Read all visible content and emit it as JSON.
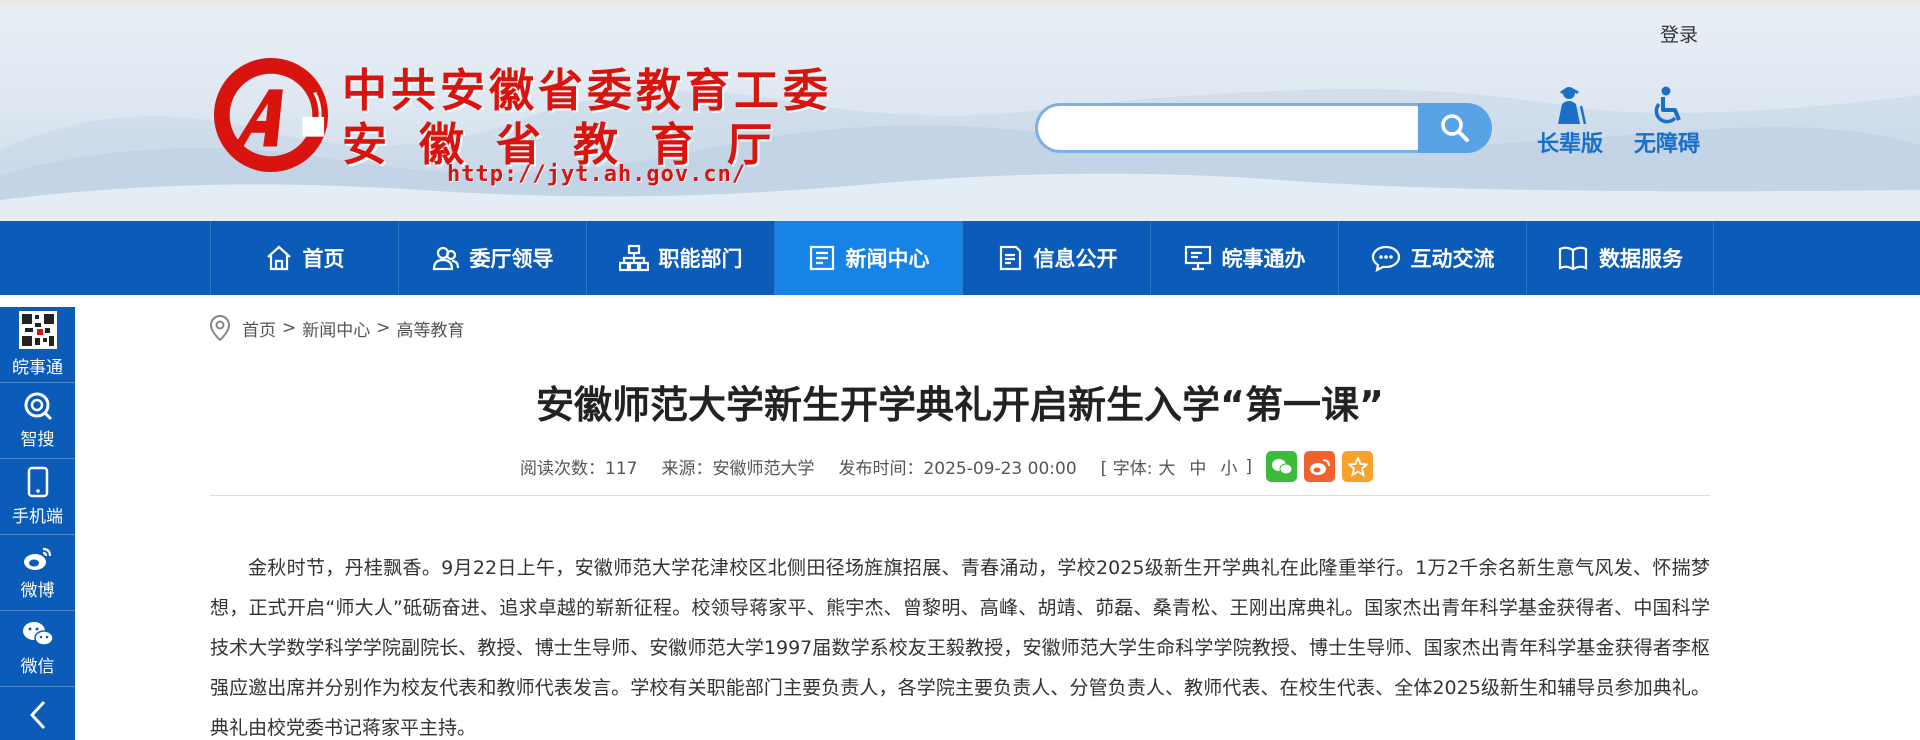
{
  "header": {
    "login": "登录",
    "logo_line1": "中共安徽省委教育工委",
    "logo_line2": "安徽省教育厅",
    "logo_url": "http://jyt.ah.gov.cn/",
    "search": {
      "placeholder": "",
      "value": ""
    },
    "links": [
      {
        "label": "长辈版",
        "icon": "elder-icon"
      },
      {
        "label": "无障碍",
        "icon": "wheelchair-icon"
      }
    ]
  },
  "nav": {
    "items": [
      {
        "label": "首页",
        "icon": "home-icon"
      },
      {
        "label": "委厅领导",
        "icon": "people-icon"
      },
      {
        "label": "职能部门",
        "icon": "org-chart-icon"
      },
      {
        "label": "新闻中心",
        "icon": "news-icon",
        "active": true
      },
      {
        "label": "信息公开",
        "icon": "document-icon"
      },
      {
        "label": "皖事通办",
        "icon": "monitor-icon"
      },
      {
        "label": "互动交流",
        "icon": "chat-icon"
      },
      {
        "label": "数据服务",
        "icon": "book-icon"
      }
    ]
  },
  "sidebar": {
    "items": [
      {
        "label": "皖事通",
        "icon": "qr-code-icon"
      },
      {
        "label": "智搜",
        "icon": "smart-search-icon"
      },
      {
        "label": "手机端",
        "icon": "mobile-icon"
      },
      {
        "label": "微博",
        "icon": "weibo-icon"
      },
      {
        "label": "微信",
        "icon": "wechat-icon"
      }
    ],
    "back_icon": "chevron-left-icon"
  },
  "breadcrumb": {
    "home": "首页",
    "sep": ">",
    "level1": "新闻中心",
    "level2": "高等教育"
  },
  "article": {
    "title": "安徽师范大学新生开学典礼开启新生入学“第一课”",
    "meta": {
      "reads": "阅读次数：117",
      "source": "来源：安徽师范大学",
      "published": "发布时间：2025-09-23 00:00",
      "font_open": "[ 字体:",
      "font_large": "大",
      "font_medium": "中",
      "font_small": "小",
      "font_close": "]"
    },
    "share": [
      {
        "name": "wechat",
        "color": "#3dbb3a"
      },
      {
        "name": "weibo",
        "color": "#f0632c"
      },
      {
        "name": "favorite",
        "color": "#f9a12d"
      }
    ],
    "body": "金秋时节，丹桂飘香。9月22日上午，安徽师范大学花津校区北侧田径场旌旗招展、青春涌动，学校2025级新生开学典礼在此隆重举行。1万2千余名新生意气风发、怀揣梦想，正式开启“师大人”砥砺奋进、追求卓越的崭新征程。校领导蒋家平、熊宇杰、曾黎明、高峰、胡靖、茆磊、桑青松、王刚出席典礼。国家杰出青年科学基金获得者、中国科学技术大学数学科学学院副院长、教授、博士生导师、安徽师范大学1997届数学系校友王毅教授，安徽师范大学生命科学学院教授、博士生导师、国家杰出青年科学基金获得者李枢强应邀出席并分别作为校友代表和教师代表发言。学校有关职能部门主要负责人，各学院主要负责人、分管负责人、教师代表、在校生代表、全体2025级新生和辅导员参加典礼。典礼由校党委书记蒋家平主持。"
  },
  "colors": {
    "nav_bg": "#0a5cb8",
    "nav_active": "#1684e6",
    "logo_red": "#d9140f",
    "link_blue": "#1a6fc8",
    "search_btn": "#5aa2e6"
  }
}
